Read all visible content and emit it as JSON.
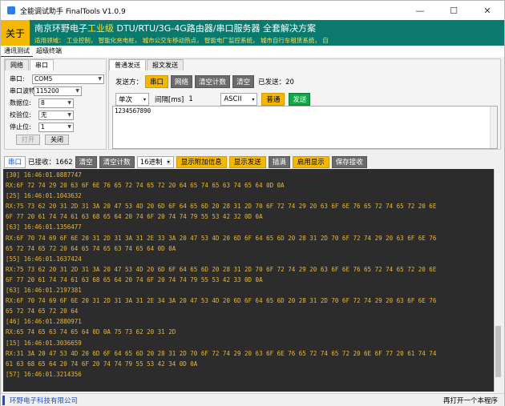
{
  "window": {
    "title": "全能调试助手 FinalTools V1.0.9"
  },
  "banner": {
    "about_label": "关于",
    "line1_a": "南京环野电子",
    "line1_hl": "工业级",
    "line1_b": " DTU/RTU/3G-4G路由器/串口服务器 全套解决方案",
    "line2": "适用领域： 工业控制， 智能化充电桩， 城市公交车移动热点， 智能电厂监控系统， 城市自行车租赁系统， 自"
  },
  "menu": [
    "通讯测试",
    "超级终端"
  ],
  "left": {
    "tabs": [
      "网络",
      "串口"
    ],
    "fields": [
      {
        "label": "串口:",
        "value": "COM5"
      },
      {
        "label": "串口波特率:",
        "value": "115200"
      },
      {
        "label": "数据位:",
        "value": "8"
      },
      {
        "label": "校验位:",
        "value": "无"
      },
      {
        "label": "停止位:",
        "value": "1"
      }
    ],
    "open_label": "打开",
    "close_label": "关闭"
  },
  "right": {
    "tabs": [
      "普通发送",
      "报文发送"
    ],
    "send_to_label": "发送方：",
    "btn_serial": "串口",
    "btn_network": "网络",
    "btn_clear_count": "清空计数",
    "btn_clear": "清空",
    "sent_count": "已发送：20",
    "mode": "单次",
    "interval_label": "间隔[ms]",
    "interval_value": "1",
    "encoding": "ASCII",
    "btn_normal": "普通",
    "btn_send": "发送",
    "send_text": "1234567890"
  },
  "recv_toolbar": {
    "tab": "串口",
    "recv_count": "已接收：1662",
    "btn_clear": "清空",
    "btn_clear_count": "清空计数",
    "format": "16进制",
    "btn_show_extra": "显示附加信息",
    "btn_show_send": "显示发送",
    "btn_wrap": "插满",
    "btn_enable_show": "启用显示",
    "btn_save": "保存接收"
  },
  "recv_lines": [
    "[30] 16:46:01.0887747",
    "RX:6F 72 74 29 20 63 6F 6E 76 65 72 74 65 72 20 64 65 74 65 63 74 65 64 0D 0A",
    "[25] 16:46:01.1043632",
    "RX:75 73 62 20 31 2D 31 3A 20 47 53 4D 20 6D 6F 64 65 6D 20 28 31 2D 70 6F 72 74 29 20 63 6F 6E 76 65 72 74 65 72 20 6E",
    "6F 77 20 61 74 74 61 63 68 65 64 20 74 6F 20 74 74 79 55 53 42 32 0D 0A",
    "[63] 16:46:01.1356477",
    "RX:6F 70 74 69 6F 6E 20 31 2D 31 3A 31 2E 33 3A 20 47 53 4D 20 6D 6F 64 65 6D 20 28 31 2D 70 6F 72 74 29 20 63 6F 6E 76",
    "65 72 74 65 72 20 64 65 74 65 63 74 65 64 0D 0A",
    "[55] 16:46:01.1637424",
    "RX:75 73 62 20 31 2D 31 3A 20 47 53 4D 20 6D 6F 64 65 6D 20 28 31 2D 70 6F 72 74 29 20 63 6F 6E 76 65 72 74 65 72 20 6E",
    "6F 77 20 61 74 74 61 63 68 65 64 20 74 6F 20 74 74 79 55 53 42 33 0D 0A",
    "[63] 16:46:01.2197381",
    "RX:6F 70 74 69 6F 6E 20 31 2D 31 3A 31 2E 34 3A 20 47 53 4D 20 6D 6F 64 65 6D 20 28 31 2D 70 6F 72 74 29 20 63 6F 6E 76",
    "65 72 74 65 72 20 64",
    "[46] 16:46:01.2880971",
    "RX:65 74 65 63 74 65 64 0D 0A 75 73 62 20 31 2D",
    "[15] 16:46:01.3036659",
    "RX:31 3A 20 47 53 4D 20 6D 6F 64 65 6D 20 28 31 2D 70 6F 72 74 29 20 63 6F 6E 76 65 72 74 65 72 20 6E 6F 77 20 61 74 74",
    "61 63 68 65 64 20 74 6F 20 74 74 79 55 53 42 34 0D 0A",
    "[57] 16:46:01.3214356"
  ],
  "status": {
    "company": "环野电子科技有限公司",
    "right_text": "再打开一个本程序"
  },
  "colors": {
    "banner_bg": "#0a7a6e",
    "accent_orange": "#f5b800",
    "recv_bg": "#2c2c2c",
    "recv_text": "#e8b83a",
    "send_green": "#16a34a"
  }
}
